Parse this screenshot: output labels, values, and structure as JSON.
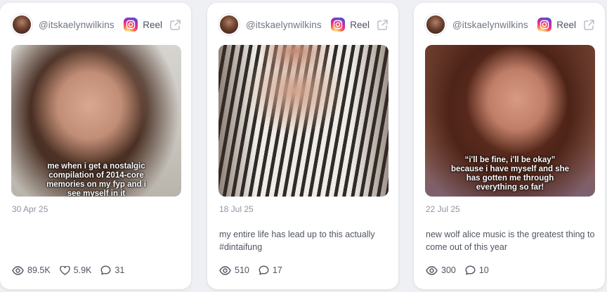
{
  "cards": [
    {
      "handle": "@itskaelynwilkins",
      "type_label": "Reel",
      "overlay_text": "me when i get a nostalgic\ncompilation of 2014-core\nmemories on my fyp and i\nsee myself in it",
      "date": "30 Apr 25",
      "description": "",
      "stats": {
        "views": "89.5K",
        "likes": "5.9K",
        "comments": "31"
      }
    },
    {
      "handle": "@itskaelynwilkins",
      "type_label": "Reel",
      "overlay_text": "",
      "date": "18 Jul 25",
      "description": "my entire life has lead up to this actually #dintaifung",
      "stats": {
        "views": "510",
        "comments": "17"
      }
    },
    {
      "handle": "@itskaelynwilkins",
      "type_label": "Reel",
      "overlay_text": "“i'll be fine, i'll be okay”\nbecause i have myself and she\nhas gotten me through\neverything so far!",
      "date": "22 Jul 25",
      "description": "new wolf alice music is the greatest thing to come out of this year",
      "stats": {
        "views": "300",
        "comments": "10"
      }
    }
  ],
  "icons": {
    "platform": "instagram-icon",
    "external": "external-link-icon",
    "views": "eye-icon",
    "likes": "heart-icon",
    "comments": "comment-icon"
  },
  "colors": {
    "page_background": "#eef0f3",
    "card_background": "#ffffff",
    "muted_text": "#8e95a1",
    "body_text": "#4f5561"
  }
}
